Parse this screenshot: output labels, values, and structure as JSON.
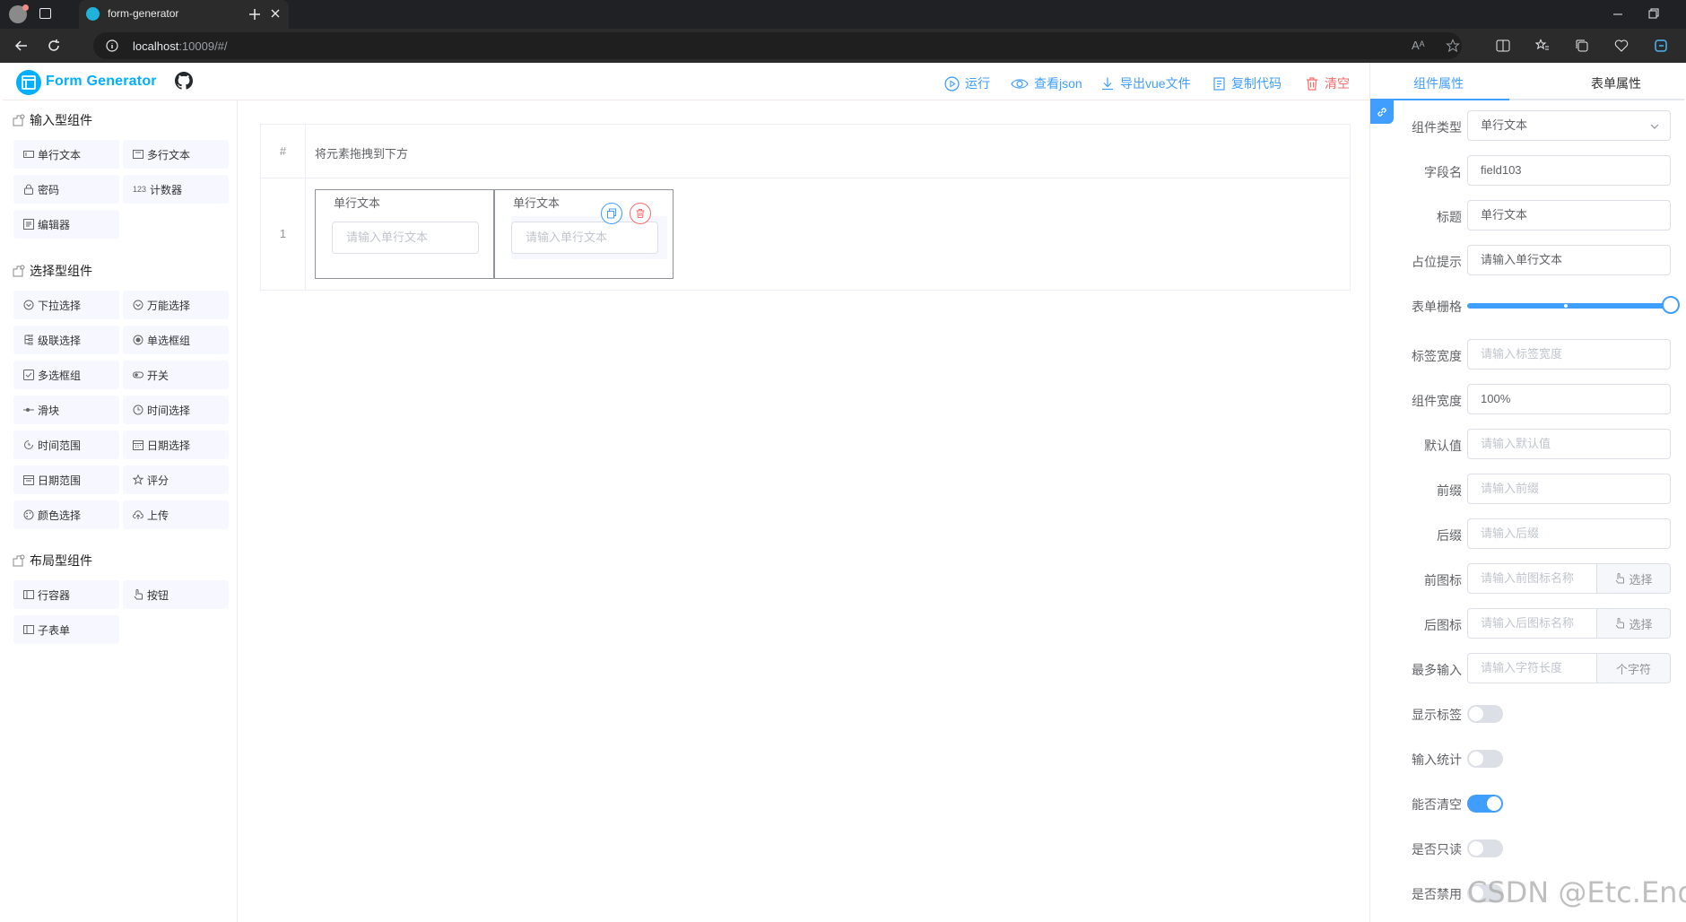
{
  "browser": {
    "tab_title": "form-generator",
    "url_host": "localhost",
    "url_rest": ":10009/#/"
  },
  "header": {
    "logo_text": "Form Generator",
    "toolbar": {
      "run": "运行",
      "view_json": "查看json",
      "export_vue": "导出vue文件",
      "copy_code": "复制代码",
      "clear": "清空"
    }
  },
  "left_panel": {
    "groups": [
      {
        "title": "输入型组件",
        "items": [
          "单行文本",
          "多行文本",
          "密码",
          "计数器",
          "编辑器"
        ]
      },
      {
        "title": "选择型组件",
        "items": [
          "下拉选择",
          "万能选择",
          "级联选择",
          "单选框组",
          "多选框组",
          "开关",
          "滑块",
          "时间选择",
          "时间范围",
          "日期选择",
          "日期范围",
          "评分",
          "颜色选择",
          "上传"
        ]
      },
      {
        "title": "布局型组件",
        "items": [
          "行容器",
          "按钮",
          "子表单"
        ]
      }
    ]
  },
  "canvas": {
    "header_index": "#",
    "hint": "将元素拖拽到下方",
    "row_index": "1",
    "fields": [
      {
        "label": "单行文本",
        "placeholder": "请输入单行文本"
      },
      {
        "label": "单行文本",
        "placeholder": "请输入单行文本"
      }
    ]
  },
  "right_panel": {
    "tabs": [
      "组件属性",
      "表单属性"
    ],
    "active_tab": "组件属性",
    "rows": {
      "type": {
        "label": "组件类型",
        "value": "单行文本"
      },
      "field": {
        "label": "字段名",
        "value": "field103"
      },
      "title": {
        "label": "标题",
        "value": "单行文本"
      },
      "placeholder": {
        "label": "占位提示",
        "value": "请输入单行文本"
      },
      "span": {
        "label": "表单栅格",
        "value": 24
      },
      "label_width": {
        "label": "标签宽度",
        "placeholder": "请输入标签宽度"
      },
      "comp_width": {
        "label": "组件宽度",
        "value": "100%"
      },
      "default": {
        "label": "默认值",
        "placeholder": "请输入默认值"
      },
      "prefix": {
        "label": "前缀",
        "placeholder": "请输入前缀"
      },
      "suffix": {
        "label": "后缀",
        "placeholder": "请输入后缀"
      },
      "prefix_icon": {
        "label": "前图标",
        "placeholder": "请输入前图标名称",
        "button": "选择"
      },
      "suffix_icon": {
        "label": "后图标",
        "placeholder": "请输入后图标名称",
        "button": "选择"
      },
      "maxlength": {
        "label": "最多输入",
        "placeholder": "请输入字符长度",
        "append": "个字符"
      },
      "show_label": {
        "label": "显示标签",
        "on": false
      },
      "word_limit": {
        "label": "输入统计",
        "on": false
      },
      "clearable": {
        "label": "能否清空",
        "on": true
      },
      "readonly": {
        "label": "是否只读",
        "on": false
      },
      "disabled": {
        "label": "是否禁用",
        "on": false
      }
    }
  },
  "watermark": "CSDN @Etc.End",
  "colors": {
    "accent": "#409eff",
    "danger": "#f56c6c",
    "logo": "#00afff"
  }
}
